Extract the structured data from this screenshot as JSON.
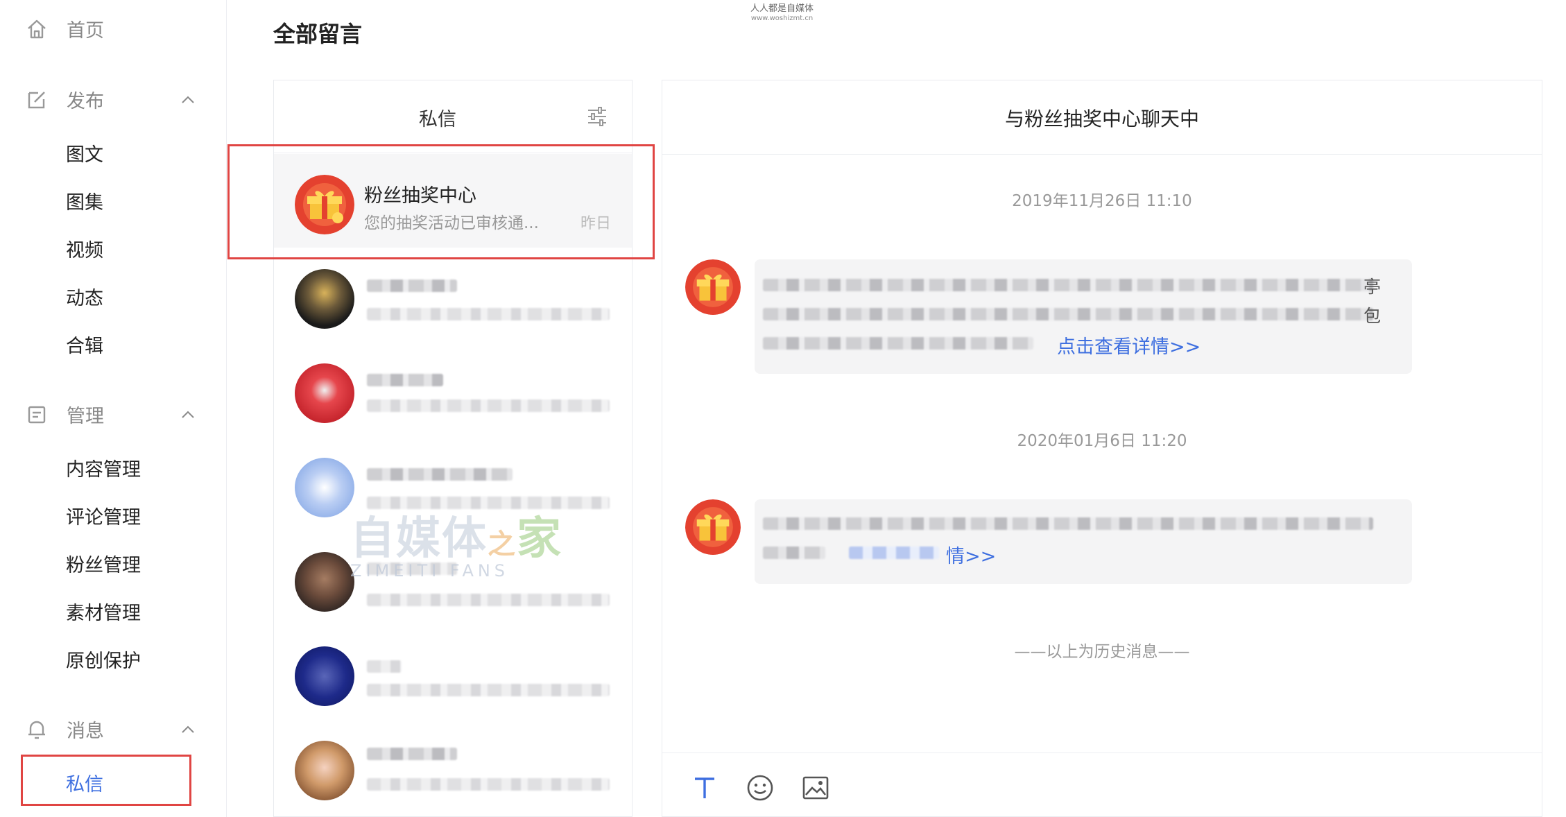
{
  "watermark_top": {
    "line1": "人人都是自媒体",
    "line2": "www.woshizmt.cn"
  },
  "sidebar": {
    "home": "首页",
    "publish": {
      "label": "发布",
      "items": [
        "图文",
        "图集",
        "视频",
        "动态",
        "合辑"
      ]
    },
    "manage": {
      "label": "管理",
      "items": [
        "内容管理",
        "评论管理",
        "粉丝管理",
        "素材管理",
        "原创保护"
      ]
    },
    "message": {
      "label": "消息",
      "items": [
        "私信"
      ]
    }
  },
  "page_title": "全部留言",
  "list": {
    "header": "私信",
    "selected": {
      "name": "粉丝抽奖中心",
      "preview": "您的抽奖活动已审核通...",
      "time": "昨日"
    }
  },
  "chat": {
    "title": "与粉丝抽奖中心聊天中",
    "messages": [
      {
        "time": "2019年11月26日 11:10",
        "link": "点击查看详情>>",
        "side_chars": [
          "亭",
          "包"
        ]
      },
      {
        "time": "2020年01月6日 11:20",
        "link": "情>>"
      }
    ],
    "history_note": "——以上为历史消息——"
  },
  "watermark_center": {
    "cn_a": "自媒体",
    "cn_b": "之",
    "cn_c": "家",
    "en": "ZIMEITI FANS"
  },
  "colors": {
    "accent": "#3e6fe0",
    "highlight": "#e04543",
    "gift_red": "#e4412f"
  }
}
